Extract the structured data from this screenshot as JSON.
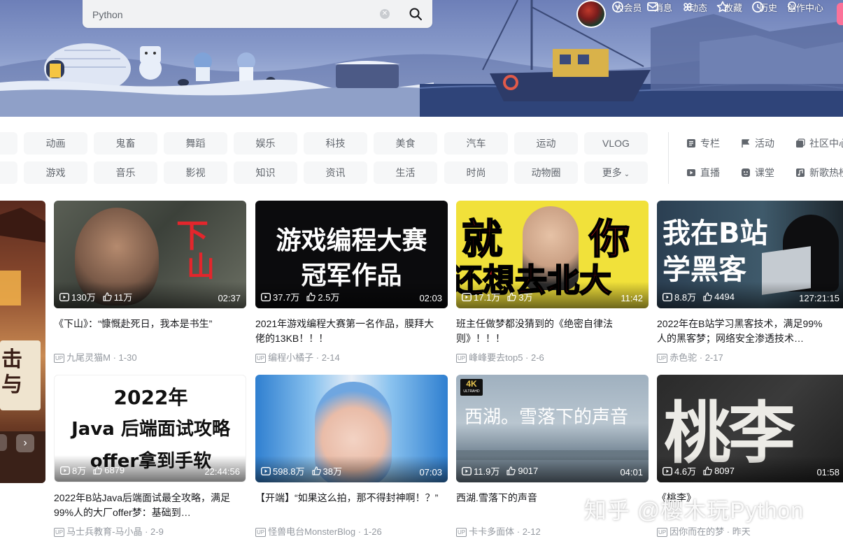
{
  "header": {
    "search_value": "Python",
    "nav": [
      {
        "label": "大会员",
        "icon": "vip-icon"
      },
      {
        "label": "消息",
        "icon": "message-icon"
      },
      {
        "label": "动态",
        "icon": "dynamic-icon"
      },
      {
        "label": "收藏",
        "icon": "star-icon"
      },
      {
        "label": "历史",
        "icon": "history-icon"
      },
      {
        "label": "创作中心",
        "icon": "creator-icon"
      }
    ]
  },
  "channels": {
    "row1": [
      "动画",
      "鬼畜",
      "舞蹈",
      "娱乐",
      "科技",
      "美食",
      "汽车",
      "运动",
      "VLOG"
    ],
    "row2": [
      "游戏",
      "音乐",
      "影视",
      "知识",
      "资讯",
      "生活",
      "时尚",
      "动物圈",
      "更多"
    ],
    "extras_row1": [
      "专栏",
      "活动",
      "社区中心"
    ],
    "extras_row2": [
      "直播",
      "课堂",
      "新歌热榜"
    ]
  },
  "carousel_text": "击与",
  "videos": [
    {
      "thumb_text": [
        "下",
        "山"
      ],
      "views": "130万",
      "likes": "11万",
      "duration": "02:37",
      "title": "《下山》：“慷慨赴死日，我本是书生”",
      "author": "九尾灵猫M",
      "date": "1-30"
    },
    {
      "thumb_text": [
        "游戏编程大赛",
        "冠军作品"
      ],
      "views": "37.7万",
      "likes": "2.5万",
      "duration": "02:03",
      "title": "2021年游戏编程大赛第一名作品，膜拜大佬的13KB！！！",
      "author": "编程小橘子",
      "date": "2-14"
    },
    {
      "thumb_text": [
        "就",
        "你",
        "还想去北大"
      ],
      "views": "17.1万",
      "likes": "3万",
      "duration": "11:42",
      "title": "班主任做梦都没猜到的《绝密自律法则》！！！",
      "author": "峰峰要去top5",
      "date": "2-6"
    },
    {
      "thumb_text": [
        "我在B站",
        "学黑客"
      ],
      "views": "8.8万",
      "likes": "4494",
      "duration": "127:21:15",
      "title": "2022年在B站学习黑客技术，满足99%人的黑客梦；网络安全渗透技术…",
      "author": "赤色驼",
      "date": "2-17"
    },
    {
      "thumb_text": [
        "2022年",
        "Java 后端面试攻略",
        "offer拿到手软"
      ],
      "views": "8万",
      "likes": "6879",
      "duration": "22:44:56",
      "title": "2022年B站Java后端面试最全攻略，满足99%人的大厂offer梦：基础到…",
      "author": "马士兵教育-马小晶",
      "date": "2-9"
    },
    {
      "thumb_text": [],
      "views": "598.8万",
      "likes": "38万",
      "duration": "07:03",
      "title": "【开端】“如果这么拍，那不得封神啊！？”",
      "author": "怪兽电台MonsterBlog",
      "date": "1-26"
    },
    {
      "thumb_text": [
        "4K",
        "ULTRAHD",
        "西湖。雪落下的声音"
      ],
      "views": "11.9万",
      "likes": "9017",
      "duration": "04:01",
      "title": "西湖.雪落下的声音",
      "author": "卡卡多面体",
      "date": "2-12"
    },
    {
      "thumb_text": [
        "桃李"
      ],
      "views": "4.6万",
      "likes": "8097",
      "duration": "01:58",
      "title": "《桃李》",
      "author": "因你而在的梦",
      "date": "昨天"
    }
  ],
  "watermark": "知乎 @樱木玩Python"
}
